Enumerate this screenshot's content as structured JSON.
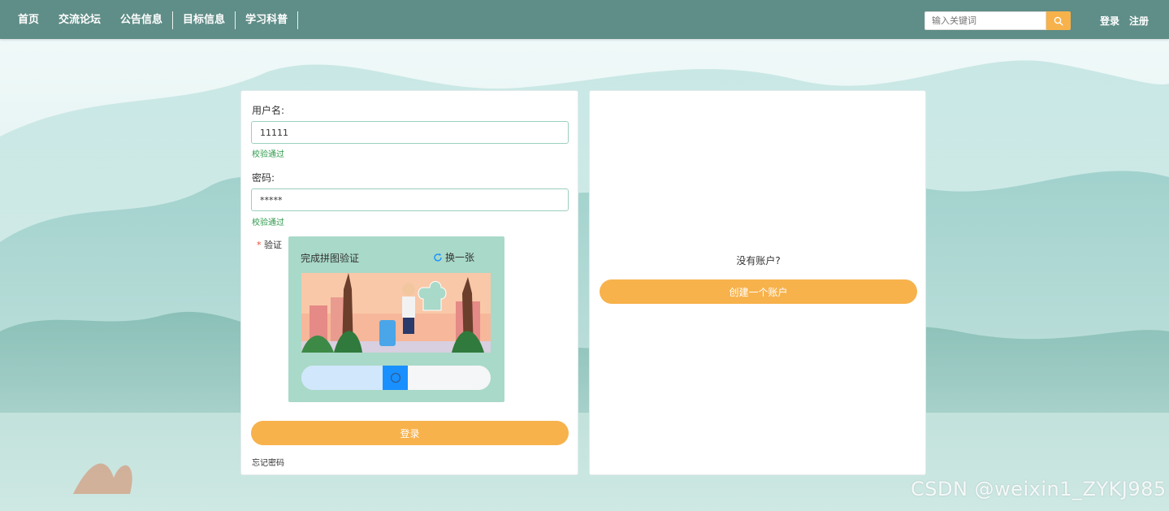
{
  "nav": {
    "items": [
      {
        "label": "首页"
      },
      {
        "label": "交流论坛"
      },
      {
        "label": "公告信息"
      },
      {
        "label": "目标信息"
      },
      {
        "label": "学习科普"
      }
    ]
  },
  "search": {
    "placeholder": "输入关键词",
    "icon": "search-icon"
  },
  "auth": {
    "login": "登录",
    "register": "注册"
  },
  "login_form": {
    "username_label": "用户名:",
    "username_value": "11111",
    "username_status": "校验通过",
    "password_label": "密码:",
    "password_value": "*****",
    "password_status": "校验通过",
    "verify_star": "*",
    "verify_label": "验证",
    "captcha": {
      "title": "完成拼图验证",
      "refresh_label": "换一张",
      "slider_progress": 0.43
    },
    "submit_label": "登录",
    "forgot_label": "忘记密码"
  },
  "register_panel": {
    "prompt": "没有账户?",
    "create_label": "创建一个账户"
  },
  "watermark": "CSDN @weixin1_ZYKJ985",
  "colors": {
    "topbar": "#5f8d87",
    "accent": "#f7b24c",
    "valid": "#2e9a4b",
    "captcha_bg": "#a9d9c8",
    "slider_handle": "#1990ff"
  }
}
